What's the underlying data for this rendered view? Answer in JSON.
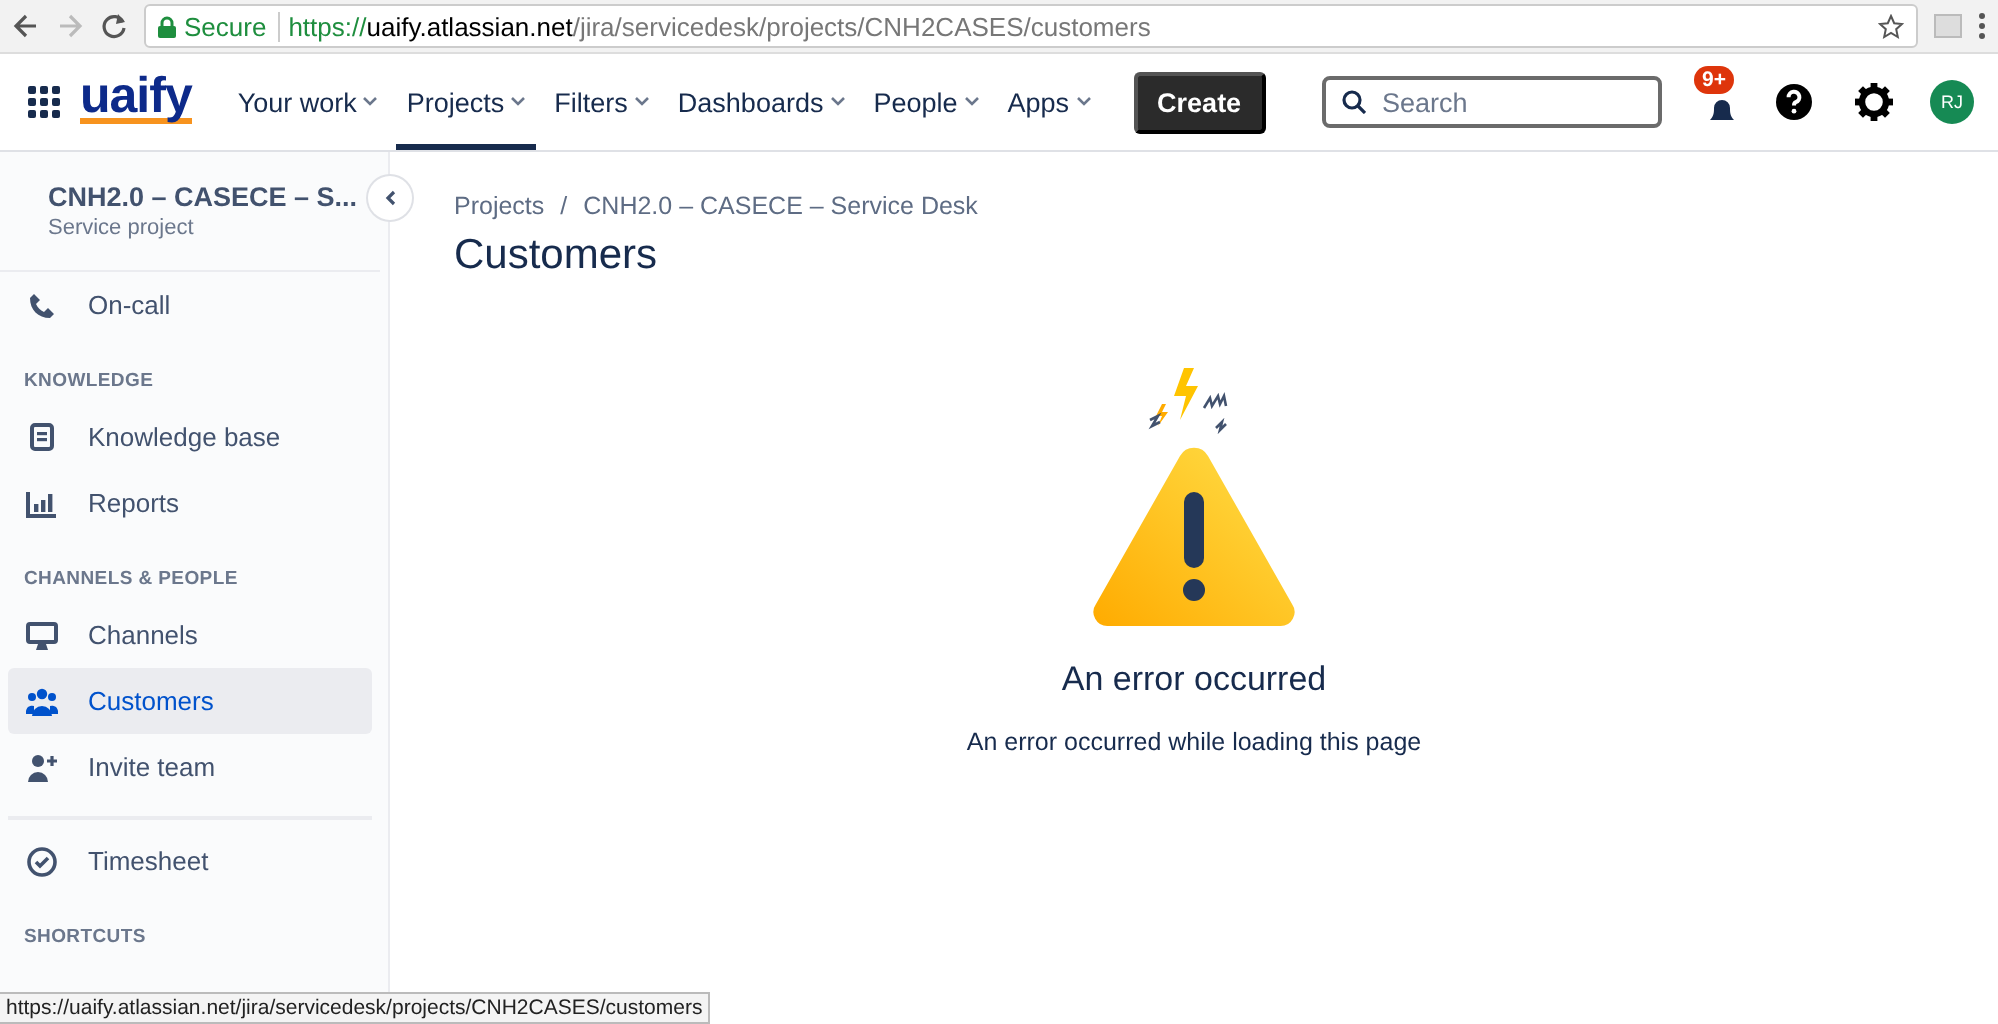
{
  "browser": {
    "secure_label": "Secure",
    "url_scheme": "https://",
    "url_host": "uaify.atlassian.net",
    "url_path": "/jira/servicedesk/projects/CNH2CASES/customers"
  },
  "nav": {
    "logo": "uaify",
    "items": [
      {
        "label": "Your work",
        "selected": false
      },
      {
        "label": "Projects",
        "selected": true
      },
      {
        "label": "Filters",
        "selected": false
      },
      {
        "label": "Dashboards",
        "selected": false
      },
      {
        "label": "People",
        "selected": false
      },
      {
        "label": "Apps",
        "selected": false
      }
    ],
    "create": "Create",
    "search": {
      "placeholder": "Search"
    },
    "notification_badge": "9+",
    "avatar": "RJ"
  },
  "sidebar": {
    "project": {
      "name": "CNH2.0 – CASECE – S...",
      "type": "Service project"
    },
    "sections": [
      {
        "items": [
          {
            "label": "On-call",
            "selected": false
          }
        ]
      },
      {
        "heading": "KNOWLEDGE",
        "items": [
          {
            "label": "Knowledge base",
            "selected": false
          },
          {
            "label": "Reports",
            "selected": false
          }
        ]
      },
      {
        "heading": "CHANNELS & PEOPLE",
        "items": [
          {
            "label": "Channels",
            "selected": false
          },
          {
            "label": "Customers",
            "selected": true
          },
          {
            "label": "Invite team",
            "selected": false
          }
        ]
      },
      {
        "divider": true,
        "items": [
          {
            "label": "Timesheet",
            "selected": false
          }
        ]
      },
      {
        "heading": "SHORTCUTS"
      }
    ]
  },
  "breadcrumbs": [
    "Projects",
    "CNH2.0 – CASECE – Service Desk"
  ],
  "breadcrumb_separator": "/",
  "page_title": "Customers",
  "error": {
    "title": "An error occurred",
    "message": "An error occurred while loading this page"
  },
  "status_url": "https://uaify.atlassian.net/jira/servicedesk/projects/CNH2CASES/customers"
}
